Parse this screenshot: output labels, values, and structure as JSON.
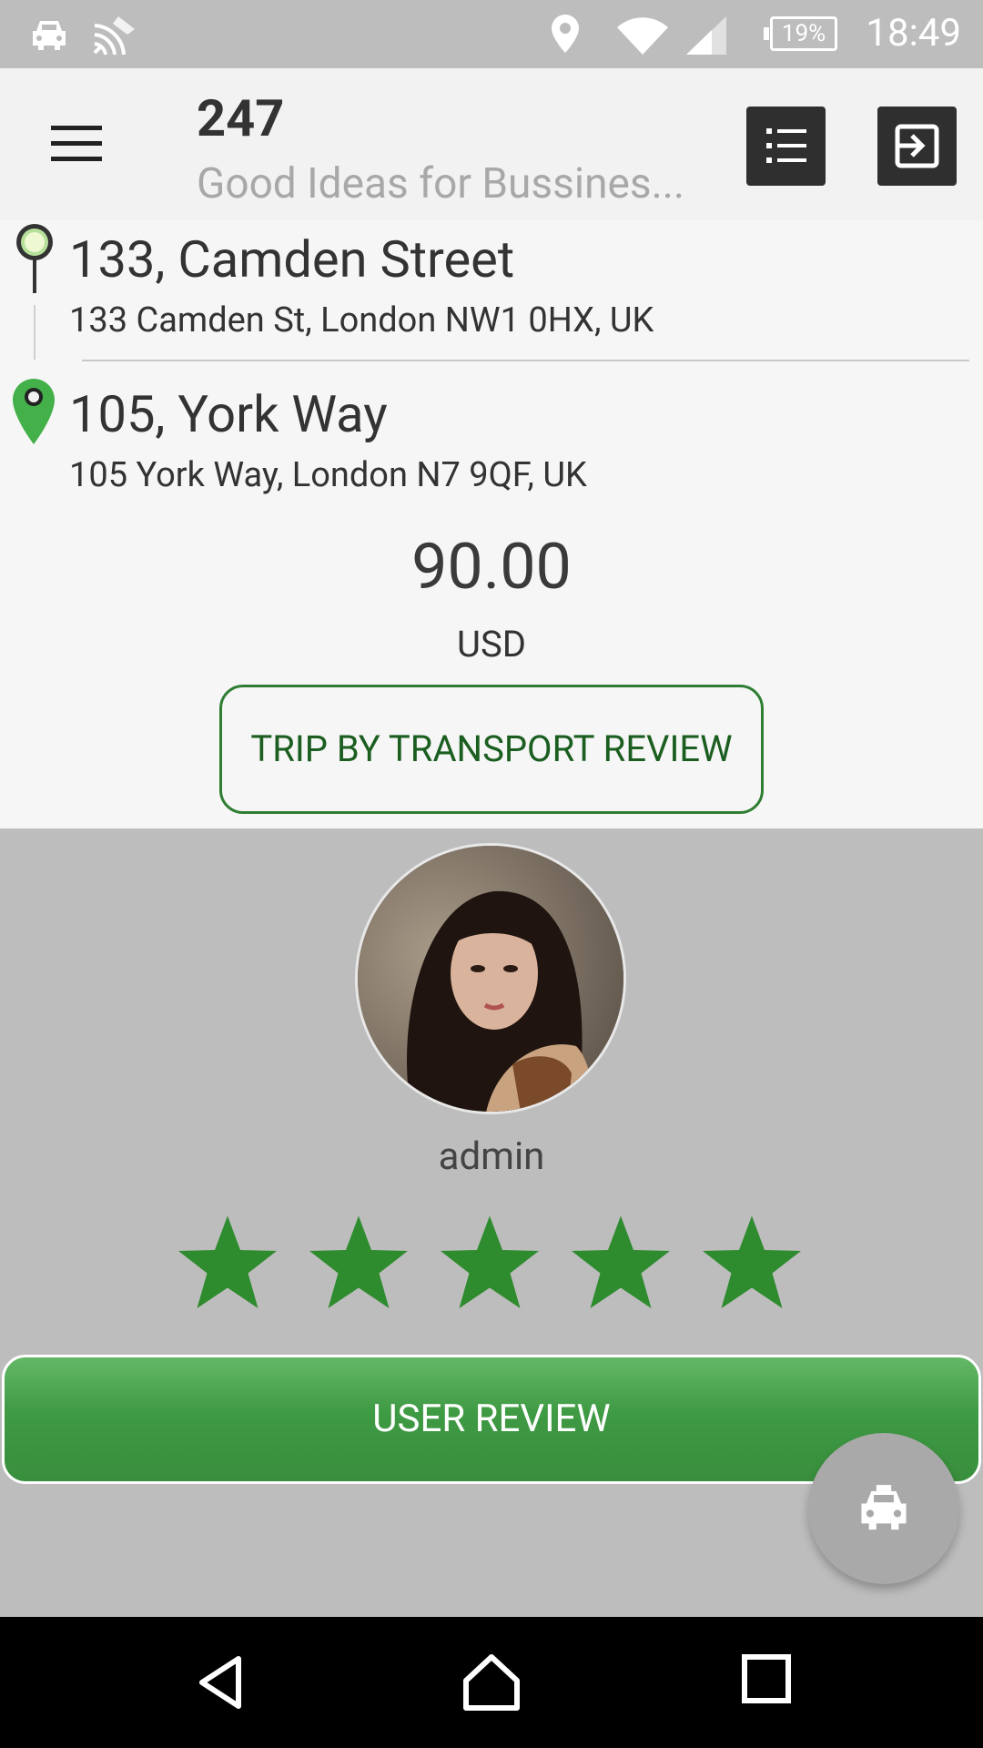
{
  "status_bar": {
    "battery": "19%",
    "time": "18:49"
  },
  "app_bar": {
    "title": "247",
    "subtitle": "Good Ideas for Bussines..."
  },
  "pickup": {
    "title": "133, Camden Street",
    "address": "133 Camden St, London NW1 0HX, UK"
  },
  "dropoff": {
    "title": "105, York Way",
    "address": "105 York Way, London N7 9QF, UK"
  },
  "fare": {
    "amount": "90.00",
    "currency": "USD"
  },
  "trip_review_button": "TRIP BY TRANSPORT REVIEW",
  "driver": {
    "name": "admin",
    "rating": 5,
    "rating_max": 5
  },
  "user_review_button": "USER REVIEW",
  "colors": {
    "accent_green": "#2e8b2e",
    "button_green": "#43a047",
    "status_bar": "#bdbdbd"
  },
  "icons": {
    "status_left": [
      "taxi-icon",
      "cast-icon"
    ],
    "status_right": [
      "location-icon",
      "wifi-icon",
      "signal-icon",
      "battery-icon"
    ],
    "toolbar": [
      "list-icon",
      "exit-icon"
    ],
    "fab": "taxi-icon",
    "nav": [
      "back-icon",
      "home-icon",
      "recents-icon"
    ]
  }
}
